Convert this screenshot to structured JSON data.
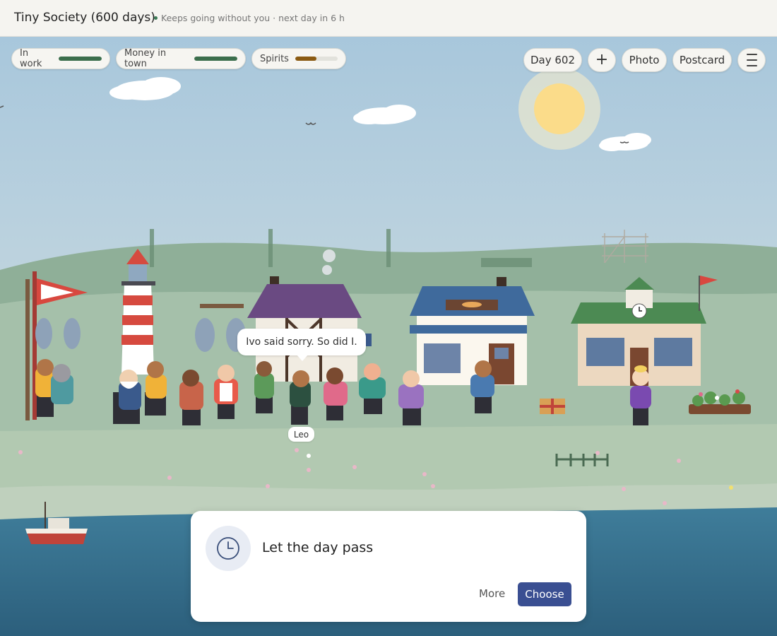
{
  "window": {
    "title": "Tiny Society (600 days)",
    "subtitle": "Keeps going without you · next day in 6 h"
  },
  "meters": [
    {
      "label": "In work",
      "level": 1.0,
      "color": "#3b6e4c"
    },
    {
      "label": "Money in town",
      "level": 1.0,
      "color": "#3b6e4c"
    },
    {
      "label": "Spirits",
      "level": 0.5,
      "color": "#8a5a12"
    }
  ],
  "toolbar": {
    "day": "Day 602",
    "add_label": "+",
    "photo_label": "Photo",
    "postcard_label": "Postcard"
  },
  "scene": {
    "speech_bubble": "Ivo said sorry. So did I.",
    "character_tag": "Leo"
  },
  "action_card": {
    "icon": "clock-icon",
    "title": "Let the day pass",
    "more_label": "More",
    "choose_label": "Choose"
  },
  "colors": {
    "accent": "#3a4f92",
    "sky": "#b8d2e2",
    "meadow": "#9ab8a0",
    "sea": "#356e8c"
  }
}
